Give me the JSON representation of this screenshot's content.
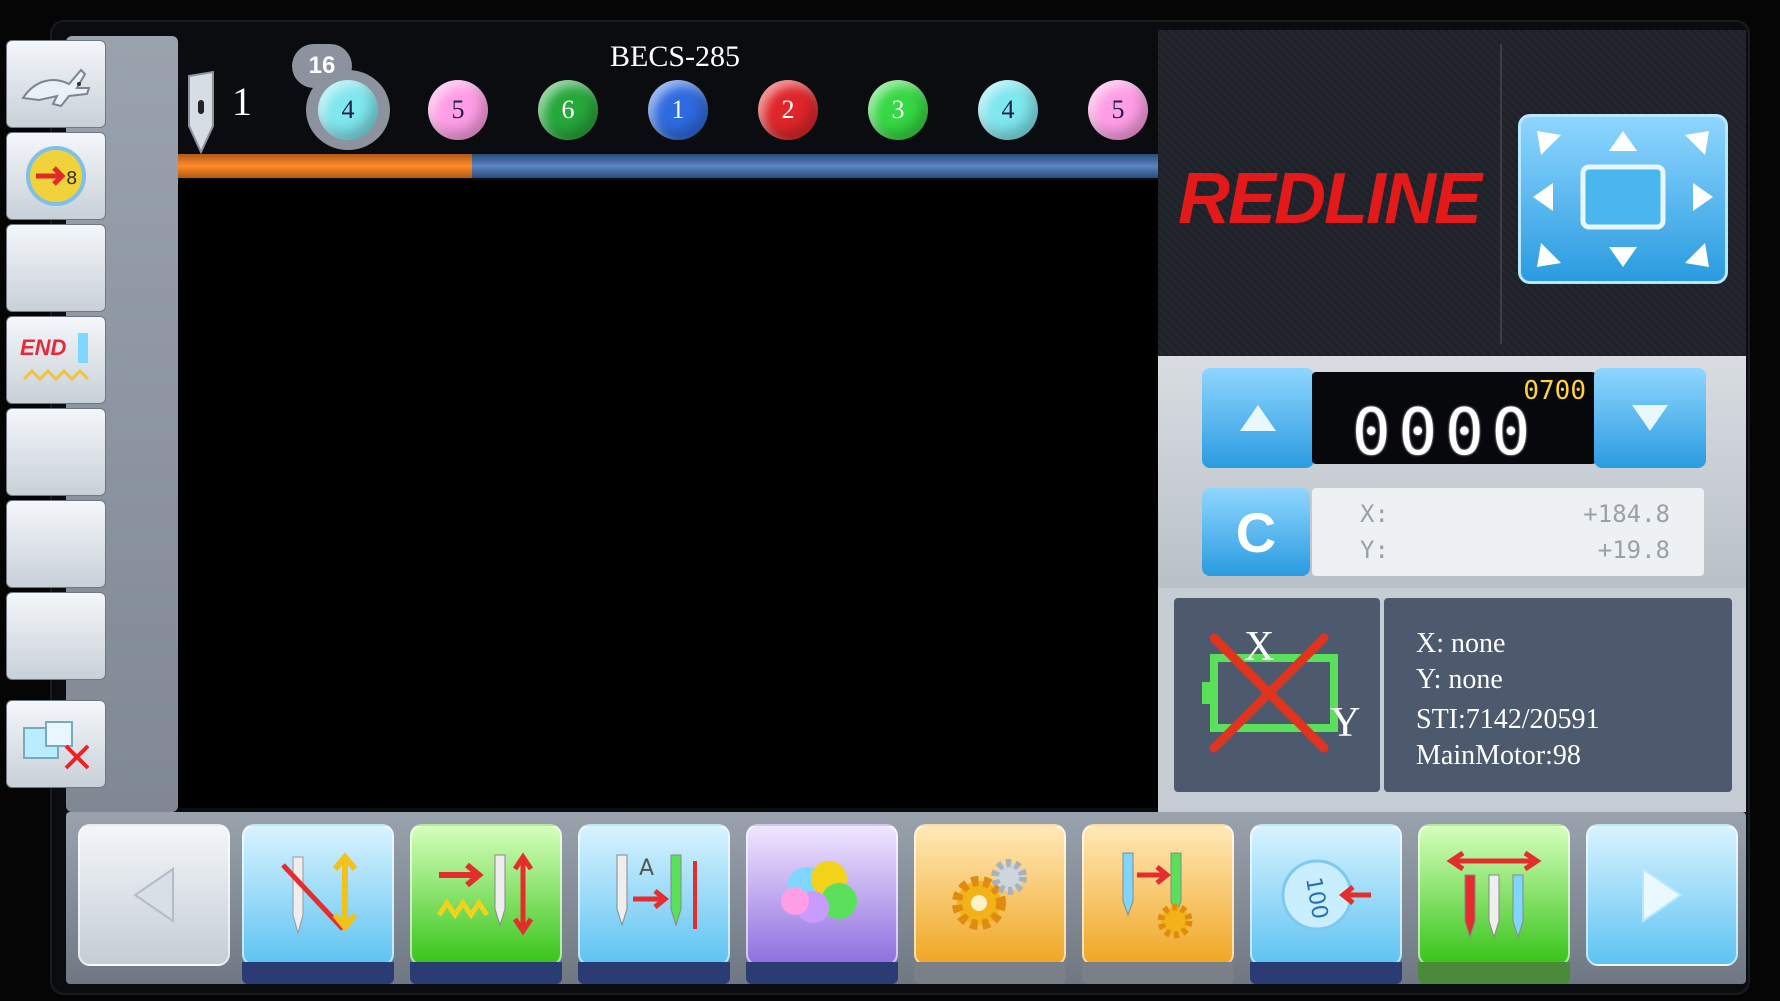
{
  "header": {
    "design_name": "BECS-285",
    "needle_number": "1",
    "color_counter": "16"
  },
  "needles": [
    {
      "label": "4",
      "color": "#7fe7ef"
    },
    {
      "label": "5",
      "color": "#ff9ee6"
    },
    {
      "label": "6",
      "color": "#27a83b"
    },
    {
      "label": "1",
      "color": "#2f6be0"
    },
    {
      "label": "2",
      "color": "#e0262a"
    },
    {
      "label": "3",
      "color": "#36d843"
    },
    {
      "label": "4",
      "color": "#7fe7ef"
    },
    {
      "label": "5",
      "color": "#ff9ee6"
    }
  ],
  "progress": {
    "fraction": 0.3
  },
  "brand": {
    "logo_text": "REDLINE",
    "color": "#e21a1a"
  },
  "speed": {
    "max": "0700",
    "current": "0000"
  },
  "clear_label": "C",
  "coords": {
    "x_label": "X:",
    "x_value": "+184.8",
    "y_label": "Y:",
    "y_value": "+19.8"
  },
  "status": {
    "x_line": "X: none",
    "y_line": "Y: none",
    "sti_line": "STI:7142/20591",
    "motor_line": "MainMotor:98",
    "frame_icon_x": "X",
    "frame_icon_y": "Y"
  },
  "left_toolbar": {
    "icons": [
      "rabbit-icon",
      "origin-return-icon",
      "blank",
      "end-icon",
      "blank",
      "blank",
      "blank",
      "clear-frame-icon"
    ],
    "end_label": "END"
  },
  "bottom_toolbar": {
    "icons": [
      "prev-page-icon",
      "needle-change-icon",
      "stitch-forward-icon",
      "needle-align-icon",
      "color-palette-icon",
      "settings-gear-icon",
      "needle-settings-icon",
      "speed-100-icon",
      "thread-trim-icon",
      "next-page-icon"
    ],
    "speed_badge": "100"
  }
}
